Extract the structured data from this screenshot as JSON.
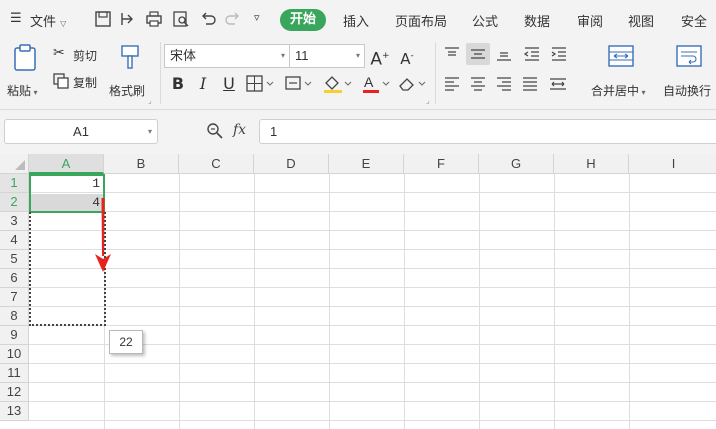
{
  "menu": {
    "file_label": "文件",
    "tabs": [
      "开始",
      "插入",
      "页面布局",
      "公式",
      "数据",
      "审阅",
      "视图",
      "安全"
    ],
    "active_tab": "开始"
  },
  "ribbon": {
    "paste_label": "粘贴",
    "cut_label": "剪切",
    "copy_label": "复制",
    "format_painter_label": "格式刷",
    "font_name": "宋体",
    "font_size": "11",
    "merge_center_label": "合并居中",
    "wrap_text_label": "自动换行"
  },
  "formula_bar": {
    "name_box": "A1",
    "fx_label": "fx",
    "value": "1"
  },
  "sheet": {
    "columns": [
      "A",
      "B",
      "C",
      "D",
      "E",
      "F",
      "G",
      "H",
      "I"
    ],
    "rows": [
      "1",
      "2",
      "3",
      "4",
      "5",
      "6",
      "7",
      "8",
      "9",
      "10",
      "11",
      "12",
      "13"
    ],
    "cells": {
      "A1": "1",
      "A2": "4"
    },
    "fill_tooltip": "22"
  },
  "colors": {
    "accent": "#3aa55c",
    "arrow": "#e8231f"
  }
}
